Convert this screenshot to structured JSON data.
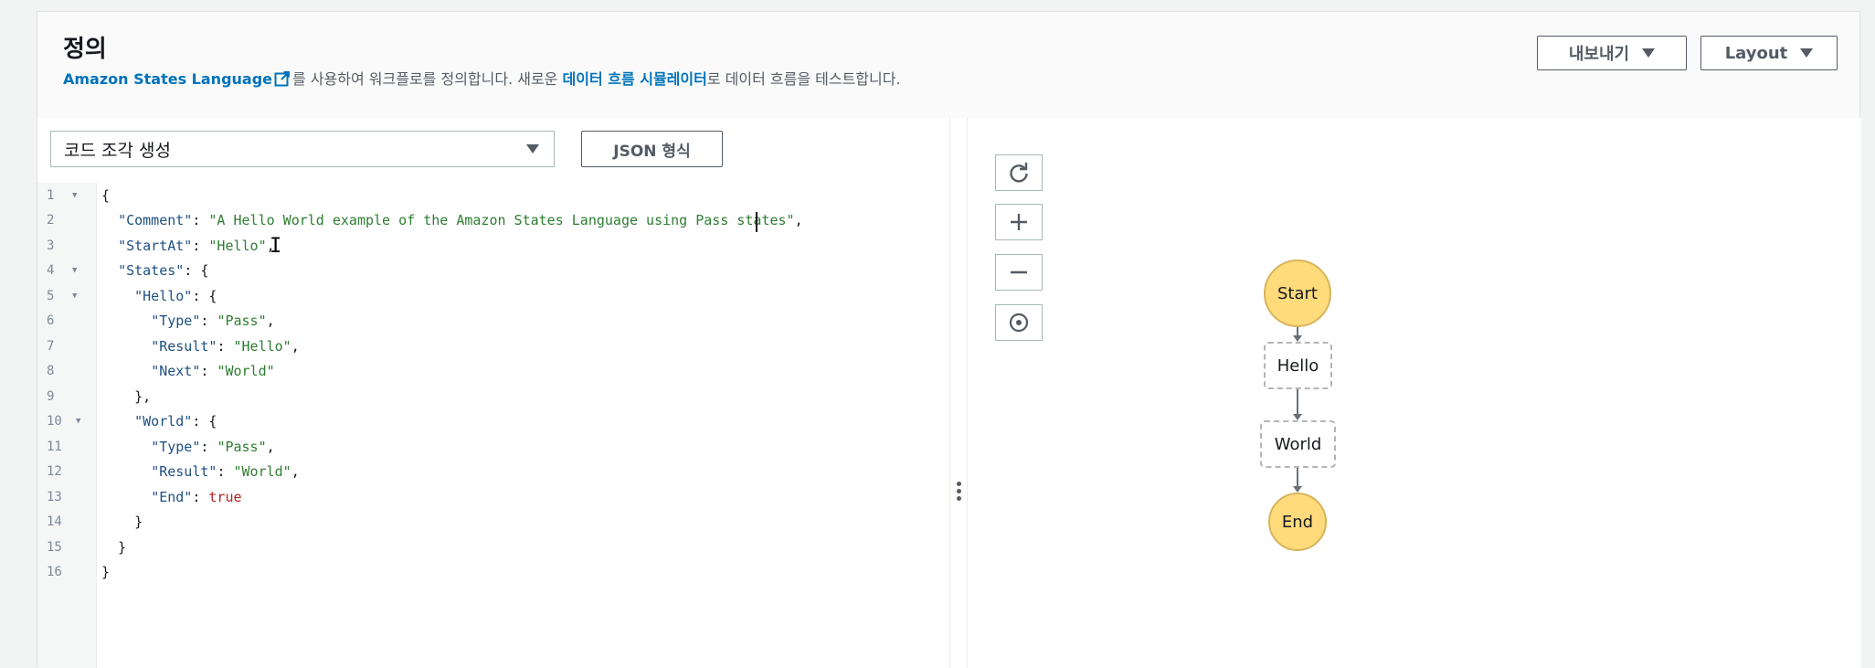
{
  "header": {
    "title": "정의",
    "desc_link": "Amazon States Language",
    "desc_text_1": "를 사용하여 워크플로를 정의합니다. 새로운 ",
    "desc_link2": "데이터 흐름 시뮬레이터",
    "desc_text_2": "로 데이터 흐름을 테스트합니다.",
    "export_label": "내보내기",
    "layout_label": "Layout"
  },
  "editor": {
    "snippet_select": "코드 조각 생성",
    "format_button": "JSON 형식",
    "lines": [
      {
        "n": "1",
        "fold": true
      },
      {
        "n": "2"
      },
      {
        "n": "3"
      },
      {
        "n": "4",
        "fold": true
      },
      {
        "n": "5",
        "fold": true
      },
      {
        "n": "6"
      },
      {
        "n": "7"
      },
      {
        "n": "8"
      },
      {
        "n": "9"
      },
      {
        "n": "10",
        "fold": true
      },
      {
        "n": "11"
      },
      {
        "n": "12"
      },
      {
        "n": "13"
      },
      {
        "n": "14"
      },
      {
        "n": "15"
      },
      {
        "n": "16"
      }
    ],
    "code": {
      "l1": "{",
      "comment_key": "\"Comment\"",
      "comment_val": "\"A Hello World example of the Amazon States Language using Pass states\"",
      "startat_key": "\"StartAt\"",
      "startat_val": "\"Hello\"",
      "states_key": "\"States\"",
      "hello_key": "\"Hello\"",
      "type_key": "\"Type\"",
      "pass_val": "\"Pass\"",
      "result_key": "\"Result\"",
      "hello_val": "\"Hello\"",
      "next_key": "\"Next\"",
      "world_val": "\"World\"",
      "world_key": "\"World\"",
      "end_key": "\"End\"",
      "true_val": "true"
    }
  },
  "graph": {
    "controls": [
      "refresh-icon",
      "zoom-in-icon",
      "zoom-out-icon",
      "center-icon"
    ],
    "nodes": {
      "start": "Start",
      "hello": "Hello",
      "world": "World",
      "end": "End"
    }
  }
}
